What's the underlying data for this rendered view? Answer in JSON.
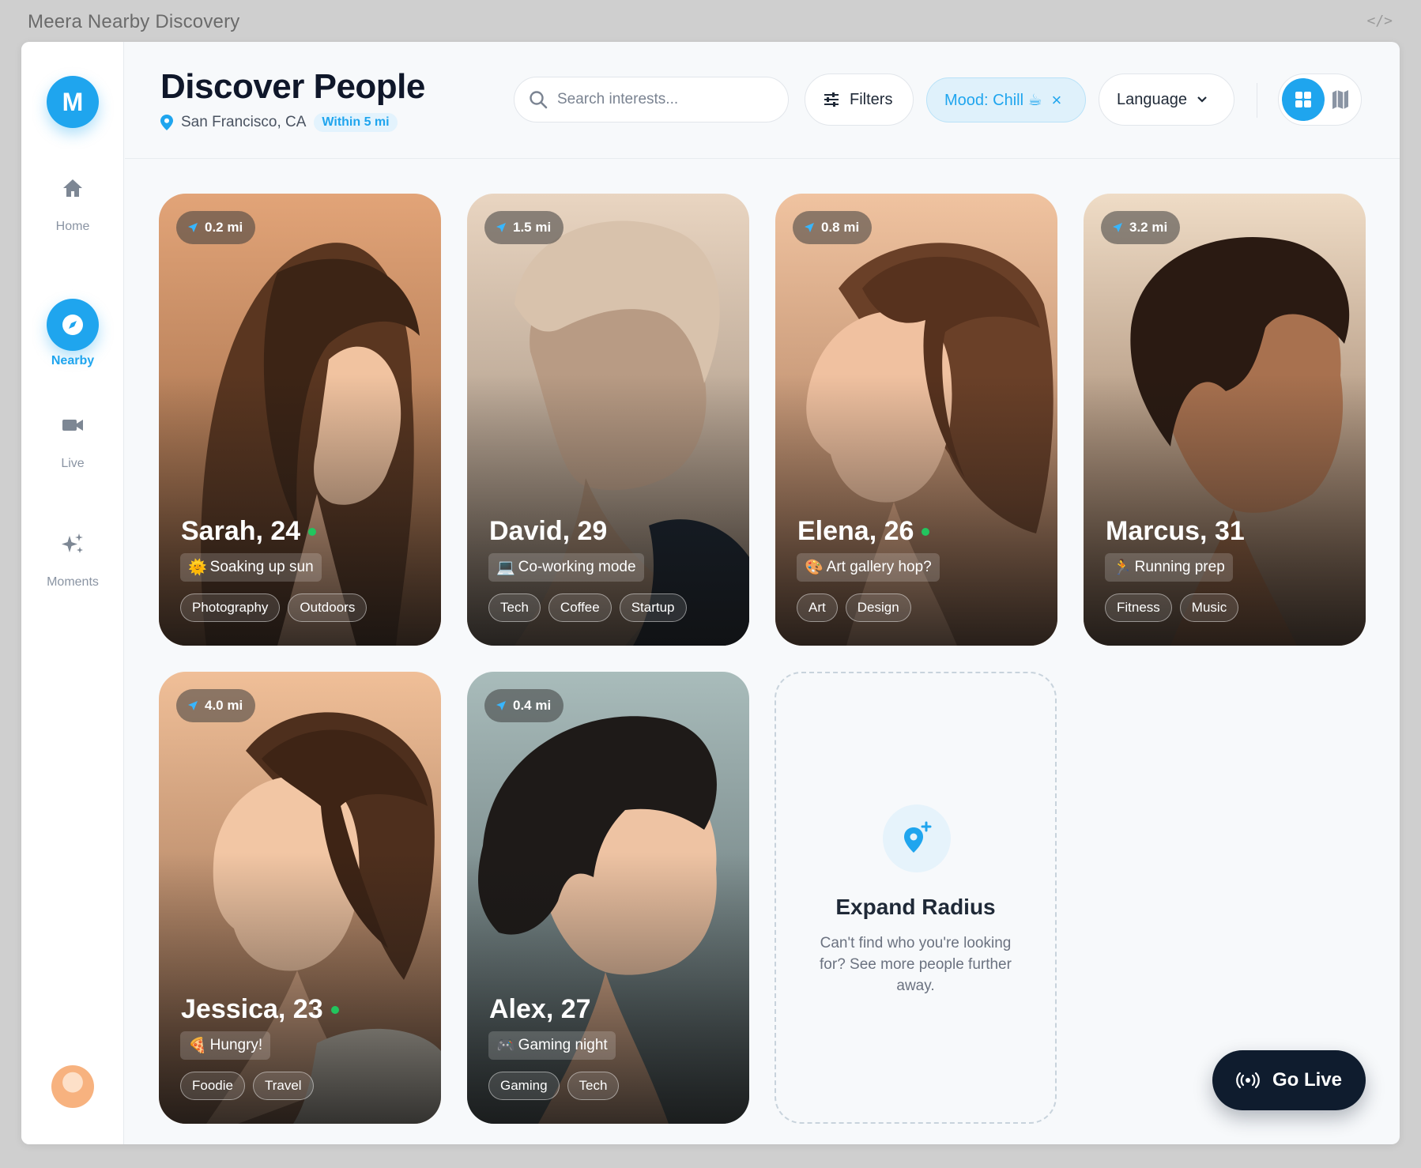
{
  "window": {
    "title": "Meera Nearby Discovery",
    "code_icon": "</>"
  },
  "sidebar": {
    "logo_letter": "M",
    "items": [
      {
        "label": "Home",
        "icon": "home-icon",
        "active": false
      },
      {
        "label": "Nearby",
        "icon": "compass-icon",
        "active": true
      },
      {
        "label": "Live",
        "icon": "video-camera-icon",
        "active": false
      },
      {
        "label": "Moments",
        "icon": "sparkles-icon",
        "active": false
      }
    ]
  },
  "header": {
    "title": "Discover People",
    "location": "San Francisco, CA",
    "radius_badge": "Within 5 mi",
    "search_placeholder": "Search interests...",
    "filters_label": "Filters",
    "mood_label": "Mood: Chill ☕",
    "mood_clear": "×",
    "language_label": "Language"
  },
  "cards": [
    {
      "distance": "0.2 mi",
      "name": "Sarah, 24",
      "online": true,
      "status_emoji": "🌞",
      "status": "Soaking up sun",
      "tags": [
        "Photography",
        "Outdoors"
      ]
    },
    {
      "distance": "1.5 mi",
      "name": "David, 29",
      "online": false,
      "status_emoji": "💻",
      "status": "Co-working mode",
      "tags": [
        "Tech",
        "Coffee",
        "Startup"
      ]
    },
    {
      "distance": "0.8 mi",
      "name": "Elena, 26",
      "online": true,
      "status_emoji": "🎨",
      "status": "Art gallery hop?",
      "tags": [
        "Art",
        "Design"
      ]
    },
    {
      "distance": "3.2 mi",
      "name": "Marcus, 31",
      "online": false,
      "status_emoji": "🏃",
      "status": "Running prep",
      "tags": [
        "Fitness",
        "Music"
      ]
    },
    {
      "distance": "4.0 mi",
      "name": "Jessica, 23",
      "online": true,
      "status_emoji": "🍕",
      "status": "Hungry!",
      "tags": [
        "Foodie",
        "Travel"
      ]
    },
    {
      "distance": "0.4 mi",
      "name": "Alex, 27",
      "online": false,
      "status_emoji": "🎮",
      "status": "Gaming night",
      "tags": [
        "Gaming",
        "Tech"
      ]
    }
  ],
  "expand": {
    "title": "Expand Radius",
    "text": "Can't find who you're looking for? See more people further away."
  },
  "go_live": {
    "label": "Go Live"
  },
  "colors": {
    "accent": "#1fa5ee",
    "dark": "#0f1c2e",
    "online": "#22c55e"
  }
}
